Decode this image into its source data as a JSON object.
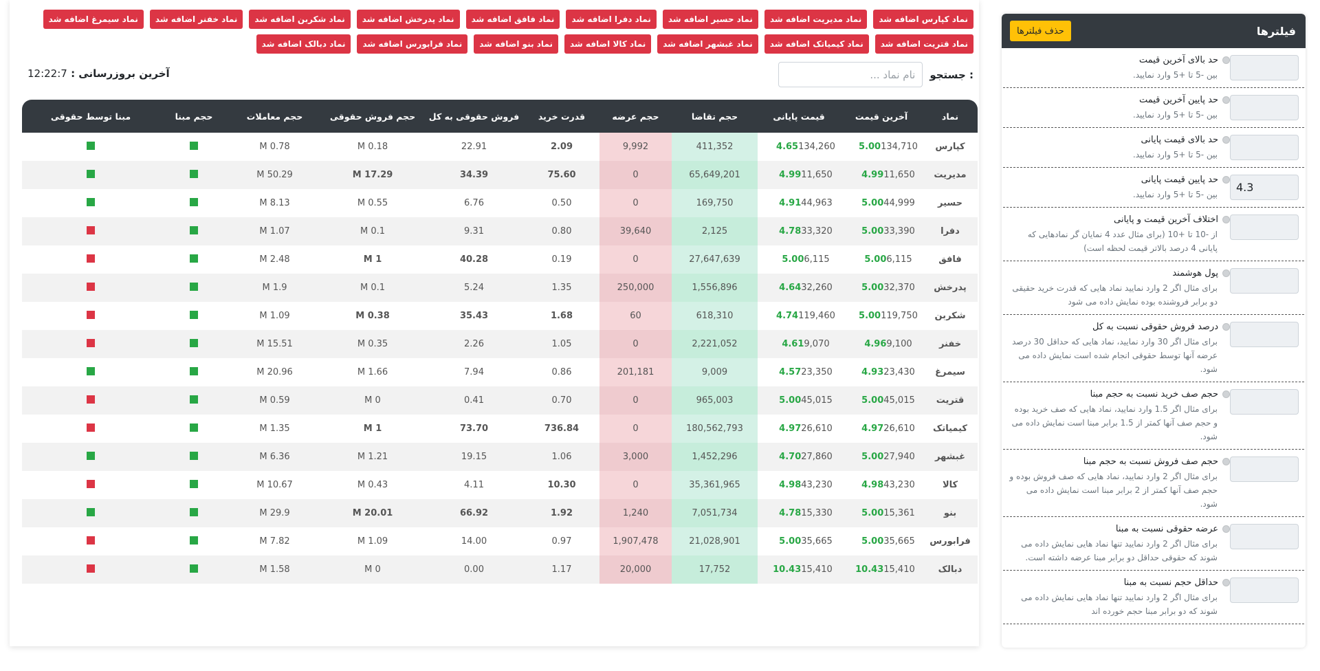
{
  "sidebar": {
    "title": "فیلترها",
    "clear_button": "حذف فیلترها",
    "filters": [
      {
        "title": "حد بالای آخرین قیمت",
        "desc": "بین -5 تا +5 وارد نمایید.",
        "value": ""
      },
      {
        "title": "حد پایین آخرین قیمت",
        "desc": "بین -5 تا +5 وارد نمایید.",
        "value": ""
      },
      {
        "title": "حد بالای قیمت پایانی",
        "desc": "بین -5 تا +5 وارد نمایید.",
        "value": ""
      },
      {
        "title": "حد پایین قیمت پایانی",
        "desc": "بین -5 تا +5 وارد نمایید.",
        "value": "4.3"
      },
      {
        "title": "اختلاف آخرین قیمت و پایانی",
        "desc": "از -10 تا +10 (برای مثال عدد 4 نمایان گر نمادهایی که پایانی 4 درصد بالاتر قیمت لحظه است)",
        "value": ""
      },
      {
        "title": "پول هوشمند",
        "desc": "برای مثال اگر 2 وارد نمایید نماد هایی که قدرت خرید حقیقی دو برابر فروشنده بوده نمایش داده می شود",
        "value": ""
      },
      {
        "title": "درصد فروش حقوقی نسبت به کل",
        "desc": "برای مثال اگر 30 وارد نمایید، نماد هایی که حداقل 30 درصد عرضه آنها توسط حقوقی انجام شده است نمایش داده می شود.",
        "value": ""
      },
      {
        "title": "حجم صف خرید نسبت به حجم مبنا",
        "desc": "برای مثال اگر 1.5 وارد نمایید، نماد هایی که صف خرید بوده و حجم صف آنها کمتر از 1.5 برابر مبنا است نمایش داده می شود.",
        "value": ""
      },
      {
        "title": "حجم صف فروش نسبت به حجم مبنا",
        "desc": "برای مثال اگر 2 وارد نمایید، نماد هایی که صف فروش بوده و حجم صف آنها کمتر از 2 برابر مبنا است نمایش داده می شود.",
        "value": ""
      },
      {
        "title": "عرضه حقوقی نسبت به مبنا",
        "desc": "برای مثال اگر 2 وارد نمایید تنها نماد هایی نمایش داده می شوند که حقوقی حداقل دو برابر مبنا عرضه داشته است.",
        "value": ""
      },
      {
        "title": "حداقل حجم نسبت به مبنا",
        "desc": "برای مثال اگر 2 وارد نمایید تنها نماد هایی نمایش داده می شوند که دو برابر مبنا حجم خورده اند",
        "value": ""
      }
    ]
  },
  "badges": [
    "نماد کپارس اضافه شد",
    "نماد مدیریت اضافه شد",
    "نماد حسیر اضافه شد",
    "نماد دفرا اضافه شد",
    "نماد فافق اضافه شد",
    "نماد پدرخش اضافه شد",
    "نماد شکربن اضافه شد",
    "نماد خفنر اضافه شد",
    "نماد سیمرغ اضافه شد",
    "نماد قتریت اضافه شد",
    "نماد کیمیاتک اضافه شد",
    "نماد غبشهر اضافه شد",
    "نماد کالا اضافه شد",
    "نماد بنو اضافه شد",
    "نماد فرابورس اضافه شد",
    "نماد دبالک اضافه شد"
  ],
  "search": {
    "label": "جستجو :",
    "placeholder": "نام نماد ..."
  },
  "update": {
    "label": "آخرین بروزرسانی :",
    "time": "12:22:7"
  },
  "table": {
    "headers": [
      "نماد",
      "آخرین قیمت",
      "قیمت پایانی",
      "حجم تقاضا",
      "حجم عرضه",
      "قدرت خرید",
      "فروش حقوقی به کل",
      "حجم فروش حقوقی",
      "حجم معاملات",
      "حجم مبنا",
      "مبنا توسط حقوقی"
    ],
    "rows": [
      {
        "sym": "کپارس",
        "last_pct": "5.00",
        "last": "134,710",
        "close_pct": "4.65",
        "close": "134,260",
        "demand": "411,352",
        "supply": "9,992",
        "power": "2.09",
        "power_bold": true,
        "legal_ratio": "22.91",
        "ratio_bold": false,
        "legal_vol": "0.18 M",
        "legal_bold": false,
        "volume": "0.78 M",
        "base": "green",
        "base_legal": "green"
      },
      {
        "sym": "مدیریت",
        "last_pct": "4.99",
        "last": "11,650",
        "close_pct": "4.99",
        "close": "11,650",
        "demand": "65,649,201",
        "supply": "0",
        "power": "75.60",
        "power_bold": true,
        "legal_ratio": "34.39",
        "ratio_bold": true,
        "legal_vol": "17.29 M",
        "legal_bold": true,
        "volume": "50.29 M",
        "base": "green",
        "base_legal": "green"
      },
      {
        "sym": "حسیر",
        "last_pct": "5.00",
        "last": "44,999",
        "close_pct": "4.91",
        "close": "44,963",
        "demand": "169,750",
        "supply": "0",
        "power": "0.50",
        "power_bold": false,
        "legal_ratio": "6.76",
        "ratio_bold": false,
        "legal_vol": "0.55 M",
        "legal_bold": false,
        "volume": "8.13 M",
        "base": "green",
        "base_legal": "green"
      },
      {
        "sym": "دفرا",
        "last_pct": "5.00",
        "last": "33,390",
        "close_pct": "4.78",
        "close": "33,320",
        "demand": "2,125",
        "supply": "39,640",
        "power": "0.80",
        "power_bold": false,
        "legal_ratio": "9.31",
        "ratio_bold": false,
        "legal_vol": "0.1 M",
        "legal_bold": false,
        "volume": "1.07 M",
        "base": "green",
        "base_legal": "red"
      },
      {
        "sym": "فافق",
        "last_pct": "5.00",
        "last": "6,115",
        "close_pct": "5.00",
        "close": "6,115",
        "demand": "27,647,639",
        "supply": "0",
        "power": "0.19",
        "power_bold": false,
        "legal_ratio": "40.28",
        "ratio_bold": true,
        "legal_vol": "1 M",
        "legal_bold": true,
        "volume": "2.48 M",
        "base": "green",
        "base_legal": "red"
      },
      {
        "sym": "پدرخش",
        "last_pct": "5.00",
        "last": "32,370",
        "close_pct": "4.64",
        "close": "32,260",
        "demand": "1,556,896",
        "supply": "250,000",
        "power": "1.35",
        "power_bold": false,
        "legal_ratio": "5.24",
        "ratio_bold": false,
        "legal_vol": "0.1 M",
        "legal_bold": false,
        "volume": "1.9 M",
        "base": "green",
        "base_legal": "red"
      },
      {
        "sym": "شکربن",
        "last_pct": "5.00",
        "last": "119,750",
        "close_pct": "4.74",
        "close": "119,460",
        "demand": "618,310",
        "supply": "60",
        "power": "1.68",
        "power_bold": true,
        "legal_ratio": "35.43",
        "ratio_bold": true,
        "legal_vol": "0.38 M",
        "legal_bold": true,
        "volume": "1.09 M",
        "base": "green",
        "base_legal": "red"
      },
      {
        "sym": "خفنر",
        "last_pct": "4.96",
        "last": "9,100",
        "close_pct": "4.61",
        "close": "9,070",
        "demand": "2,221,052",
        "supply": "0",
        "power": "1.05",
        "power_bold": false,
        "legal_ratio": "2.26",
        "ratio_bold": false,
        "legal_vol": "0.35 M",
        "legal_bold": false,
        "volume": "15.51 M",
        "base": "green",
        "base_legal": "red"
      },
      {
        "sym": "سیمرغ",
        "last_pct": "4.93",
        "last": "23,430",
        "close_pct": "4.57",
        "close": "23,350",
        "demand": "9,009",
        "supply": "201,181",
        "power": "0.86",
        "power_bold": false,
        "legal_ratio": "7.94",
        "ratio_bold": false,
        "legal_vol": "1.66 M",
        "legal_bold": false,
        "volume": "20.96 M",
        "base": "green",
        "base_legal": "green"
      },
      {
        "sym": "قتریت",
        "last_pct": "5.00",
        "last": "45,015",
        "close_pct": "5.00",
        "close": "45,015",
        "demand": "965,003",
        "supply": "0",
        "power": "0.70",
        "power_bold": false,
        "legal_ratio": "0.41",
        "ratio_bold": false,
        "legal_vol": "0 M",
        "legal_bold": false,
        "volume": "0.59 M",
        "base": "green",
        "base_legal": "red"
      },
      {
        "sym": "کیمیاتک",
        "last_pct": "4.97",
        "last": "26,610",
        "close_pct": "4.97",
        "close": "26,610",
        "demand": "180,562,793",
        "supply": "0",
        "power": "736.84",
        "power_bold": true,
        "legal_ratio": "73.70",
        "ratio_bold": true,
        "legal_vol": "1 M",
        "legal_bold": true,
        "volume": "1.35 M",
        "base": "green",
        "base_legal": "red"
      },
      {
        "sym": "غبشهر",
        "last_pct": "5.00",
        "last": "27,940",
        "close_pct": "4.70",
        "close": "27,860",
        "demand": "1,452,296",
        "supply": "3,000",
        "power": "1.06",
        "power_bold": false,
        "legal_ratio": "19.15",
        "ratio_bold": false,
        "legal_vol": "1.21 M",
        "legal_bold": false,
        "volume": "6.36 M",
        "base": "green",
        "base_legal": "green"
      },
      {
        "sym": "کالا",
        "last_pct": "4.98",
        "last": "43,230",
        "close_pct": "4.98",
        "close": "43,230",
        "demand": "35,361,965",
        "supply": "0",
        "power": "10.30",
        "power_bold": true,
        "legal_ratio": "4.11",
        "ratio_bold": false,
        "legal_vol": "0.43 M",
        "legal_bold": false,
        "volume": "10.67 M",
        "base": "green",
        "base_legal": "red"
      },
      {
        "sym": "بنو",
        "last_pct": "5.00",
        "last": "15,361",
        "close_pct": "4.78",
        "close": "15,330",
        "demand": "7,051,734",
        "supply": "1,240",
        "power": "1.92",
        "power_bold": true,
        "legal_ratio": "66.92",
        "ratio_bold": true,
        "legal_vol": "20.01 M",
        "legal_bold": true,
        "volume": "29.9 M",
        "base": "green",
        "base_legal": "green"
      },
      {
        "sym": "فرابورس",
        "last_pct": "5.00",
        "last": "35,665",
        "close_pct": "5.00",
        "close": "35,665",
        "demand": "21,028,901",
        "supply": "1,907,478",
        "power": "0.97",
        "power_bold": false,
        "legal_ratio": "14.00",
        "ratio_bold": false,
        "legal_vol": "1.09 M",
        "legal_bold": false,
        "volume": "7.82 M",
        "base": "green",
        "base_legal": "red"
      },
      {
        "sym": "دبالک",
        "last_pct": "10.43",
        "last": "15,410",
        "close_pct": "10.43",
        "close": "15,410",
        "demand": "17,752",
        "supply": "20,000",
        "power": "1.17",
        "power_bold": false,
        "legal_ratio": "0.00",
        "ratio_bold": false,
        "legal_vol": "0 M",
        "legal_bold": false,
        "volume": "1.58 M",
        "base": "green",
        "base_legal": "red"
      }
    ]
  },
  "colors": {
    "accent_red": "#dc3545",
    "positive_green": "#28a745",
    "header_dark": "#343a40",
    "warning_yellow": "#ffc107"
  }
}
